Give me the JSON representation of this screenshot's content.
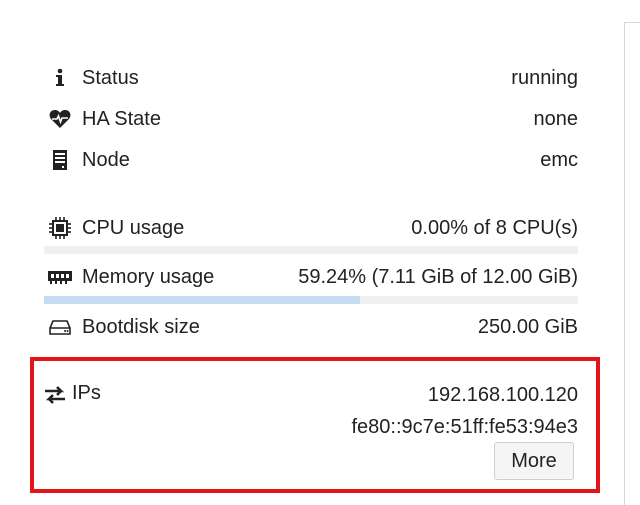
{
  "summary": {
    "status": {
      "label": "Status",
      "value": "running",
      "icon": "info-icon"
    },
    "ha_state": {
      "label": "HA State",
      "value": "none",
      "icon": "heartbeat-icon"
    },
    "node": {
      "label": "Node",
      "value": "emc",
      "icon": "server-icon"
    },
    "cpu": {
      "label": "CPU usage",
      "value": "0.00% of 8 CPU(s)",
      "icon": "cpu-chip-icon",
      "percent": 0.0
    },
    "memory": {
      "label": "Memory usage",
      "value": "59.24% (7.11 GiB of 12.00 GiB)",
      "icon": "memory-icon",
      "percent": 59.24
    },
    "bootdisk": {
      "label": "Bootdisk size",
      "value": "250.00 GiB",
      "icon": "hdd-icon"
    },
    "ips": {
      "label": "IPs",
      "icon": "exchange-arrows-icon",
      "addresses": [
        "192.168.100.120",
        "fe80::9c7e:51ff:fe53:94e3"
      ],
      "more_label": "More"
    }
  },
  "colors": {
    "progress_fill": "#c4dbf1",
    "highlight": "#e4141b",
    "accent": "#3a7cc7"
  }
}
